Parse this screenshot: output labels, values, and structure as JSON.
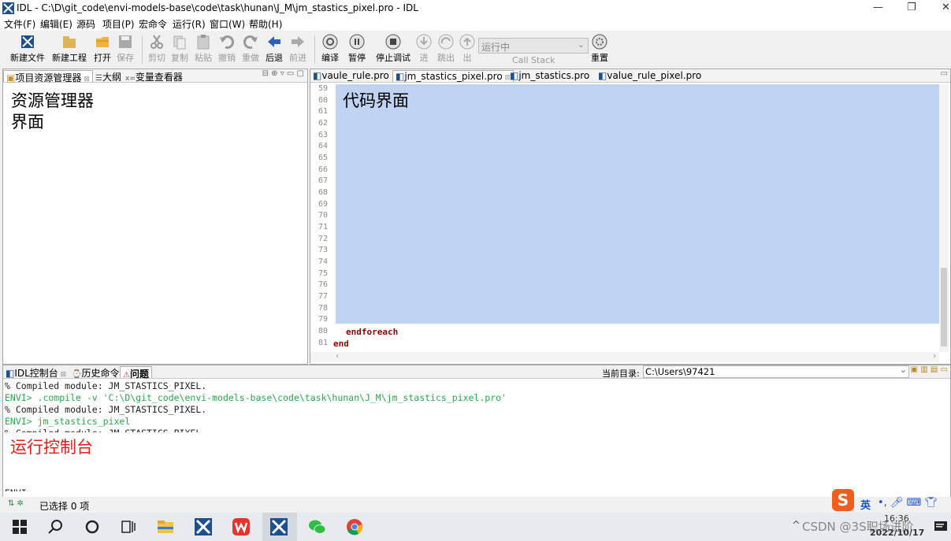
{
  "window": {
    "title": "IDL  -  C:\\D\\git_code\\envi-models-base\\code\\task\\hunan\\J_M\\jm_stastics_pixel.pro  -  IDL",
    "minimize": "—",
    "restore": "❐",
    "close": "✕"
  },
  "menu": [
    "文件(F)",
    "编辑(E)",
    "源码",
    "项目(P)",
    "宏命令",
    "运行(R)",
    "窗口(W)",
    "帮助(H)"
  ],
  "toolbar": {
    "new_file": "新建文件",
    "new_project": "新建工程",
    "open": "打开",
    "save": "保存",
    "cut": "剪切",
    "copy": "复制",
    "paste": "粘贴",
    "undo": "撤销",
    "redo": "重做",
    "back": "后退",
    "forward": "前进",
    "compile": "编译",
    "pause": "暂停",
    "stop_debug": "停止调试",
    "step_into": "进",
    "step_over": "跳出",
    "step_out": "出",
    "run_state": "运行中",
    "call_stack": "Call Stack",
    "reset": "重置"
  },
  "left_pane": {
    "tabs": [
      "项目资源管理器",
      "大纲",
      "变量查看器"
    ],
    "annotation": [
      "资源管理器",
      "界面"
    ]
  },
  "editor": {
    "tabs": [
      "vaule_rule.pro",
      "jm_stastics_pixel.pro",
      "jm_stastics.pro",
      "value_rule_pixel.pro"
    ],
    "line_numbers": [
      "59",
      "60",
      "61",
      "62",
      "63",
      "64",
      "65",
      "66",
      "67",
      "68",
      "69",
      "70",
      "71",
      "72",
      "73",
      "74",
      "75",
      "76",
      "77",
      "78",
      "79",
      "80",
      "81"
    ],
    "code_lines": [
      "endforeach",
      "end"
    ],
    "annotation": "代码界面"
  },
  "console": {
    "tabs": [
      "IDL控制台",
      "历史命令",
      "问题"
    ],
    "current_dir_label": "当前目录:",
    "current_dir_value": "C:\\Users\\97421",
    "lines": [
      "% Compiled module: JM_STASTICS_PIXEL.",
      "ENVI> .compile -v 'C:\\D\\git_code\\envi-models-base\\code\\task\\hunan\\J_M\\jm_stastics_pixel.pro'",
      "% Compiled module: JM_STASTICS_PIXEL.",
      "ENVI> jm_stastics_pixel",
      "% Compiled module: JM_STASTICS_PIXEL."
    ],
    "annotation": "运行控制台",
    "prompt_fragment": "ENVI>"
  },
  "status": {
    "selected": "已选择 0 项"
  },
  "ime": {
    "lang": "英"
  },
  "taskbar": {
    "time": "16:36",
    "date": "2022/10/17",
    "tray_text": "CSDN @3S职场进阶",
    "tray_prefix": "^"
  },
  "colors": {
    "selection": "#bfd3f2",
    "keyword": "#8b0000",
    "console_green": "#2aa84a",
    "annotation_red": "#e0201a"
  }
}
